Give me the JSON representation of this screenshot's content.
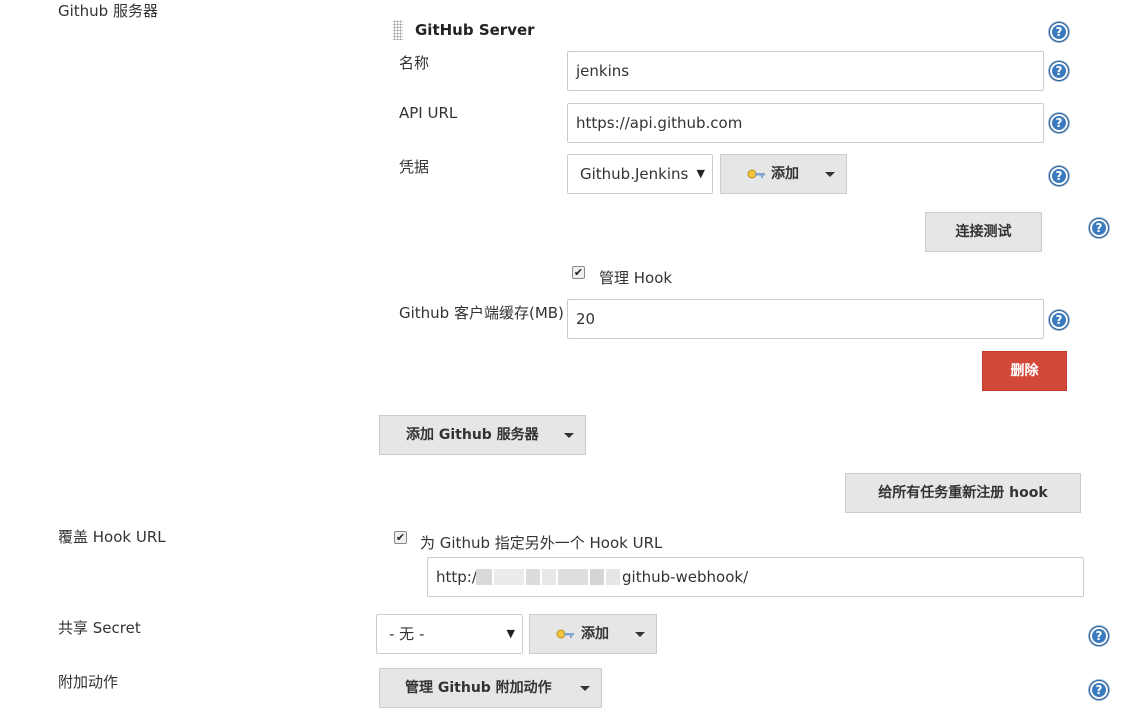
{
  "labels": {
    "github_servers": "Github 服务器",
    "name": "名称",
    "api_url": "API URL",
    "credentials": "凭据",
    "cache": "Github 客户端缓存(MB)",
    "override_hook_url": "覆盖 Hook URL",
    "shared_secret": "共享 Secret",
    "additional_actions": "附加动作"
  },
  "server": {
    "title": "GitHub Server",
    "name_value": "jenkins",
    "api_url_value": "https://api.github.com",
    "credential_selected": "Github.Jenkins",
    "add_label": "添加",
    "test_connection_label": "连接测试",
    "manage_hook_label": "管理 Hook",
    "manage_hook_checked": true,
    "cache_value": "20",
    "delete_label": "删除"
  },
  "add_server_label": "添加 Github 服务器",
  "reregister_label": "给所有任务重新注册 hook",
  "hook": {
    "checkbox_label": "为 Github 指定另外一个 Hook URL",
    "checked": true,
    "url_prefix": "http://",
    "url_suffix": "github-webhook/"
  },
  "secret": {
    "selected": "- 无 -",
    "add_label": "添加"
  },
  "additional_actions_button": "管理 Github 附加动作",
  "help_glyph": "?",
  "check_glyph": "✔",
  "select_caret": "▼",
  "colors": {
    "help_blue": "#3a7bbf",
    "delete_red": "#d24939",
    "button_gray": "#e6e6e6"
  },
  "icons": {
    "help": "help-icon",
    "credentials": "key-icon",
    "drag": "drag-handle-icon"
  }
}
